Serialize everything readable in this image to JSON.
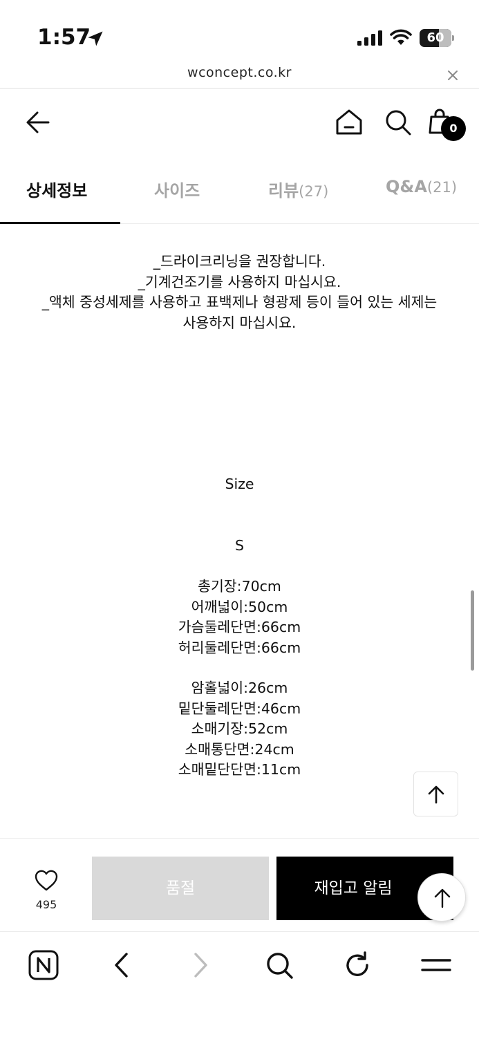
{
  "status_bar": {
    "time": "1:57",
    "battery": "60",
    "battery_level": 0.6
  },
  "url_bar": {
    "url": "wconcept.co.kr"
  },
  "header": {
    "cart_count": "0"
  },
  "tabs": [
    {
      "label": "상세정보",
      "count": ""
    },
    {
      "label": "사이즈",
      "count": ""
    },
    {
      "label": "리뷰",
      "count": "(27)"
    },
    {
      "label": "Q&A",
      "count": "(21)"
    }
  ],
  "content": {
    "care_lines": [
      "_드라이크리닝을 권장합니다.",
      "_기계건조기를 사용하지 마십시요.",
      "_액체 중성세제를 사용하고 표백제나 형광제 등이 들어 있는 세제는",
      "사용하지 마십시요."
    ],
    "size_title": "Size",
    "size_label": "S",
    "measures_group1": [
      "총기장:70cm",
      "어깨넓이:50cm",
      "가슴둘레단면:66cm",
      "허리둘레단면:66cm"
    ],
    "measures_group2": [
      "암홀넓이:26cm",
      "밑단둘레단면:46cm",
      "소매기장:52cm",
      "소매통단면:24cm",
      "소매밑단단면:11cm"
    ]
  },
  "action_bar": {
    "like_count": "495",
    "soldout_label": "품절",
    "restock_label": "재입고 알림"
  }
}
